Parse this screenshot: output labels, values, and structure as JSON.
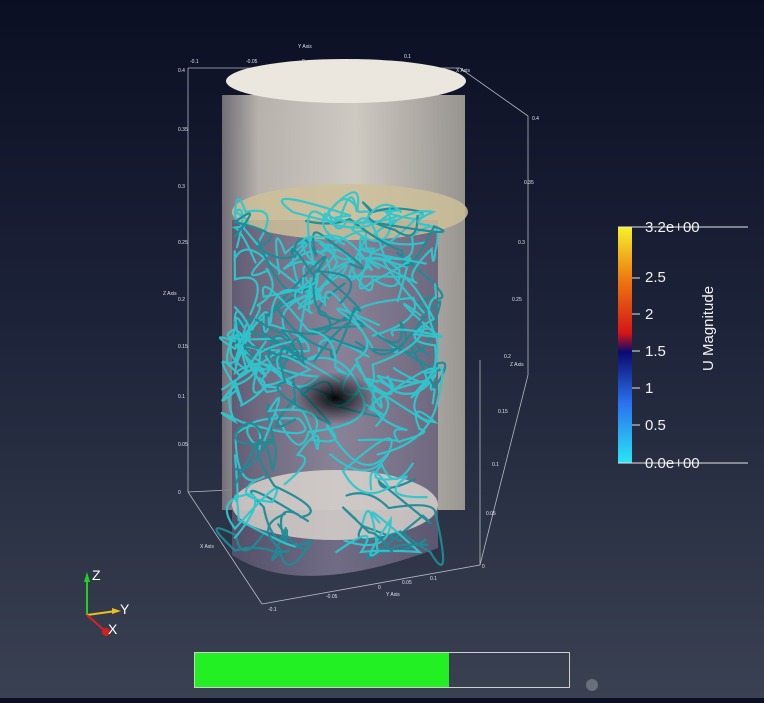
{
  "colors": {
    "streamline": "#2ec7cf",
    "cylinder_top": "#e7e2d7",
    "cylinder_body": "#d6d0c6",
    "liquid_surface": "#d6c8a5",
    "progress_fill": "#22f022",
    "axis_x": "#e02020",
    "axis_y": "#e0c020",
    "axis_z": "#20d020"
  },
  "axes_grid": {
    "y_axis_title": "Y Axis",
    "x_axis_title": "X Axis",
    "z_axis_title": "Z Axis",
    "z_ticks_left": [
      "0.4",
      "0.35",
      "0.3",
      "0.25",
      "0.2",
      "0.15",
      "0.1",
      "0.05",
      "0"
    ],
    "z_ticks_right": [
      "0.4",
      "0.35",
      "0.3",
      "0.25",
      "0.2",
      "0.15",
      "0.1",
      "0.05",
      "0"
    ],
    "y_ticks_top": [
      "-0.1",
      "-0.05",
      "0",
      "0.05",
      "0.1"
    ],
    "y_ticks_bottom": [
      "0.1",
      "0.05",
      "0",
      "-0.05",
      "-0.1"
    ]
  },
  "legend": {
    "title": "U Magnitude",
    "labels": [
      "3.2e+00",
      "2.5",
      "2",
      "1.5",
      "1",
      "0.5",
      "0.0e+00"
    ]
  },
  "orientation_axes": {
    "z": "Z",
    "y": "Y",
    "x": "X"
  },
  "progress": {
    "value": 0.68
  }
}
